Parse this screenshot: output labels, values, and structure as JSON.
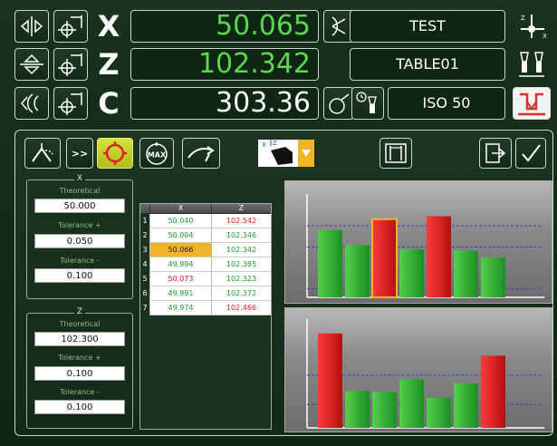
{
  "dro": {
    "rows": [
      {
        "axis": "X",
        "value": "50.065",
        "name": "TEST",
        "value_color": "green"
      },
      {
        "axis": "Z",
        "value": "102.342",
        "name": "TABLE01",
        "value_color": "green"
      },
      {
        "axis": "C",
        "value": "303.36",
        "name": "ISO 50",
        "value_color": "white"
      }
    ]
  },
  "toolbar": {
    "double_chevron": ">>",
    "max_label": "MAX"
  },
  "tolerance_x": {
    "title": "X",
    "theoretical_label": "Theoretical",
    "theoretical": "50.000",
    "tol_plus_label": "Tolerance +",
    "tol_plus": "0.050",
    "tol_minus_label": "Tolerance -",
    "tol_minus": "0.100"
  },
  "tolerance_z": {
    "title": "Z",
    "theoretical_label": "Theoretical",
    "theoretical": "102.300",
    "tol_plus_label": "Tolerance +",
    "tol_plus": "0.100",
    "tol_minus_label": "Tolerance -",
    "tol_minus": "0.100"
  },
  "table": {
    "headers": [
      "X",
      "Z"
    ],
    "rows": [
      {
        "n": "1",
        "x": "50.040",
        "z": "102.542",
        "x_status": "ok",
        "z_status": "bad"
      },
      {
        "n": "2",
        "x": "50.004",
        "z": "102.346",
        "x_status": "ok",
        "z_status": "ok"
      },
      {
        "n": "3",
        "x": "50.066",
        "z": "102.342",
        "x_status": "selected",
        "z_status": "ok"
      },
      {
        "n": "4",
        "x": "49.994",
        "z": "102.385",
        "x_status": "ok",
        "z_status": "ok"
      },
      {
        "n": "5",
        "x": "50.073",
        "z": "102.323",
        "x_status": "bad",
        "z_status": "ok"
      },
      {
        "n": "6",
        "x": "49.991",
        "z": "102.372",
        "x_status": "ok",
        "z_status": "ok"
      },
      {
        "n": "7",
        "x": "49.974",
        "z": "102.466",
        "x_status": "ok",
        "z_status": "bad"
      }
    ]
  },
  "colors": {
    "ok": "#1f9a2e",
    "bad": "#e02020",
    "selected_bg": "#f0b429",
    "value_green": "#5ed451",
    "accent_yellow": "#d6e23a"
  }
}
